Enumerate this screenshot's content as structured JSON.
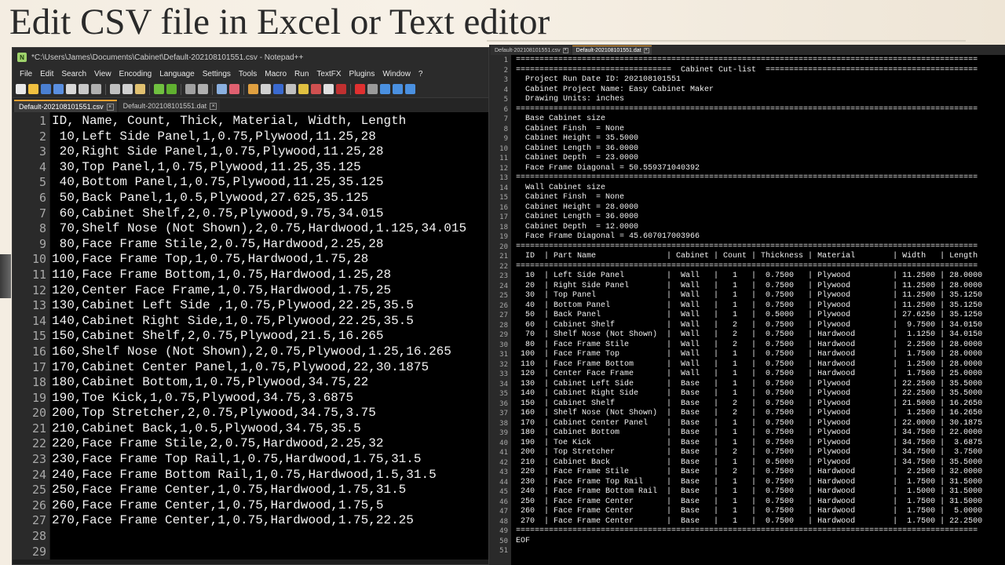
{
  "slide": {
    "title": "Edit CSV file in Excel or Text editor"
  },
  "notepad": {
    "window_title": "*C:\\Users\\James\\Documents\\Cabinet\\Default-202108101551.csv - Notepad++",
    "menu": [
      "File",
      "Edit",
      "Search",
      "View",
      "Encoding",
      "Language",
      "Settings",
      "Tools",
      "Macro",
      "Run",
      "TextFX",
      "Plugins",
      "Window",
      "?"
    ],
    "tabs": [
      {
        "label": "Default-202108101551.csv",
        "active": true
      },
      {
        "label": "Default-202108101551.dat",
        "active": false
      }
    ],
    "lines": [
      "ID, Name, Count, Thick, Material, Width, Length",
      " 10,Left Side Panel,1,0.75,Plywood,11.25,28",
      " 20,Right Side Panel,1,0.75,Plywood,11.25,28",
      " 30,Top Panel,1,0.75,Plywood,11.25,35.125",
      " 40,Bottom Panel,1,0.75,Plywood,11.25,35.125",
      " 50,Back Panel,1,0.5,Plywood,27.625,35.125",
      " 60,Cabinet Shelf,2,0.75,Plywood,9.75,34.015",
      " 70,Shelf Nose (Not Shown),2,0.75,Hardwood,1.125,34.015",
      " 80,Face Frame Stile,2,0.75,Hardwood,2.25,28",
      "100,Face Frame Top,1,0.75,Hardwood,1.75,28",
      "110,Face Frame Bottom,1,0.75,Hardwood,1.25,28",
      "120,Center Face Frame,1,0.75,Hardwood,1.75,25",
      "130,Cabinet Left Side ,1,0.75,Plywood,22.25,35.5",
      "140,Cabinet Right Side,1,0.75,Plywood,22.25,35.5",
      "150,Cabinet Shelf,2,0.75,Plywood,21.5,16.265",
      "160,Shelf Nose (Not Shown),2,0.75,Plywood,1.25,16.265",
      "170,Cabinet Center Panel,1,0.75,Plywood,22,30.1875",
      "180,Cabinet Bottom,1,0.75,Plywood,34.75,22",
      "190,Toe Kick,1,0.75,Plywood,34.75,3.6875",
      "200,Top Stretcher,2,0.75,Plywood,34.75,3.75",
      "210,Cabinet Back,1,0.5,Plywood,34.75,35.5",
      "220,Face Frame Stile,2,0.75,Hardwood,2.25,32",
      "230,Face Frame Top Rail,1,0.75,Hardwood,1.75,31.5",
      "240,Face Frame Bottom Rail,1,0.75,Hardwood,1.5,31.5",
      "250,Face Frame Center,1,0.75,Hardwood,1.75,31.5",
      "260,Face Frame Center,1,0.75,Hardwood,1.75,5",
      "270,Face Frame Center,1,0.75,Hardwood,1.75,22.25",
      "",
      ""
    ]
  },
  "dat": {
    "tabs": [
      {
        "label": "Default-202108101551.csv",
        "active": false
      },
      {
        "label": "Default-202108101551.dat",
        "active": true
      }
    ],
    "lines": [
      "==================================================================================================",
      "=================================  Cabinet Cut-list  =============================================",
      "  Project Run Date ID: 202108101551",
      "  Cabinet Project Name: Easy Cabinet Maker",
      "  Drawing Units: inches",
      "==================================================================================================",
      "  Base Cabinet size",
      "  Cabinet Finsh  = None",
      "  Cabinet Height = 35.5000",
      "  Cabinet Length = 36.0000",
      "  Cabinet Depth  = 23.0000",
      "  Face Frame Diagonal = 50.559371040392",
      "==================================================================================================",
      "  Wall Cabinet size",
      "  Cabinet Finsh  = None",
      "  Cabinet Height = 28.0000",
      "  Cabinet Length = 36.0000",
      "  Cabinet Depth  = 12.0000",
      "  Face Frame Diagonal = 45.607017003966",
      "==================================================================================================",
      "  ID  | Part Name               | Cabinet | Count | Thickness | Material        | Width   | Length",
      "==================================================================================================",
      "  10  | Left Side Panel         |  Wall   |   1   |  0.7500   | Plywood         | 11.2500 | 28.0000",
      "  20  | Right Side Panel        |  Wall   |   1   |  0.7500   | Plywood         | 11.2500 | 28.0000",
      "  30  | Top Panel               |  Wall   |   1   |  0.7500   | Plywood         | 11.2500 | 35.1250",
      "  40  | Bottom Panel            |  Wall   |   1   |  0.7500   | Plywood         | 11.2500 | 35.1250",
      "  50  | Back Panel              |  Wall   |   1   |  0.5000   | Plywood         | 27.6250 | 35.1250",
      "  60  | Cabinet Shelf           |  Wall   |   2   |  0.7500   | Plywood         |  9.7500 | 34.0150",
      "  70  | Shelf Nose (Not Shown)  |  Wall   |   2   |  0.7500   | Hardwood        |  1.1250 | 34.0150",
      "  80  | Face Frame Stile        |  Wall   |   2   |  0.7500   | Hardwood        |  2.2500 | 28.0000",
      " 100  | Face Frame Top          |  Wall   |   1   |  0.7500   | Hardwood        |  1.7500 | 28.0000",
      " 110  | Face Frame Bottom       |  Wall   |   1   |  0.7500   | Hardwood        |  1.2500 | 28.0000",
      " 120  | Center Face Frame       |  Wall   |   1   |  0.7500   | Hardwood        |  1.7500 | 25.0000",
      " 130  | Cabinet Left Side       |  Base   |   1   |  0.7500   | Plywood         | 22.2500 | 35.5000",
      " 140  | Cabinet Right Side      |  Base   |   1   |  0.7500   | Plywood         | 22.2500 | 35.5000",
      " 150  | Cabinet Shelf           |  Base   |   2   |  0.7500   | Plywood         | 21.5000 | 16.2650",
      " 160  | Shelf Nose (Not Shown)  |  Base   |   2   |  0.7500   | Plywood         |  1.2500 | 16.2650",
      " 170  | Cabinet Center Panel    |  Base   |   1   |  0.7500   | Plywood         | 22.0000 | 30.1875",
      " 180  | Cabinet Bottom          |  Base   |   1   |  0.7500   | Plywood         | 34.7500 | 22.0000",
      " 190  | Toe Kick                |  Base   |   1   |  0.7500   | Plywood         | 34.7500 |  3.6875",
      " 200  | Top Stretcher           |  Base   |   2   |  0.7500   | Plywood         | 34.7500 |  3.7500",
      " 210  | Cabinet Back            |  Base   |   1   |  0.5000   | Plywood         | 34.7500 | 35.5000",
      " 220  | Face Frame Stile        |  Base   |   2   |  0.7500   | Hardwood        |  2.2500 | 32.0000",
      " 230  | Face Frame Top Rail     |  Base   |   1   |  0.7500   | Hardwood        |  1.7500 | 31.5000",
      " 240  | Face Frame Bottom Rail  |  Base   |   1   |  0.7500   | Hardwood        |  1.5000 | 31.5000",
      " 250  | Face Frame Center       |  Base   |   1   |  0.7500   | Hardwood        |  1.7500 | 31.5000",
      " 260  | Face Frame Center       |  Base   |   1   |  0.7500   | Hardwood        |  1.7500 |  5.0000",
      " 270  | Face Frame Center       |  Base   |   1   |  0.7500   | Hardwood        |  1.7500 | 22.2500",
      "==================================================================================================",
      "EOF",
      ""
    ]
  }
}
